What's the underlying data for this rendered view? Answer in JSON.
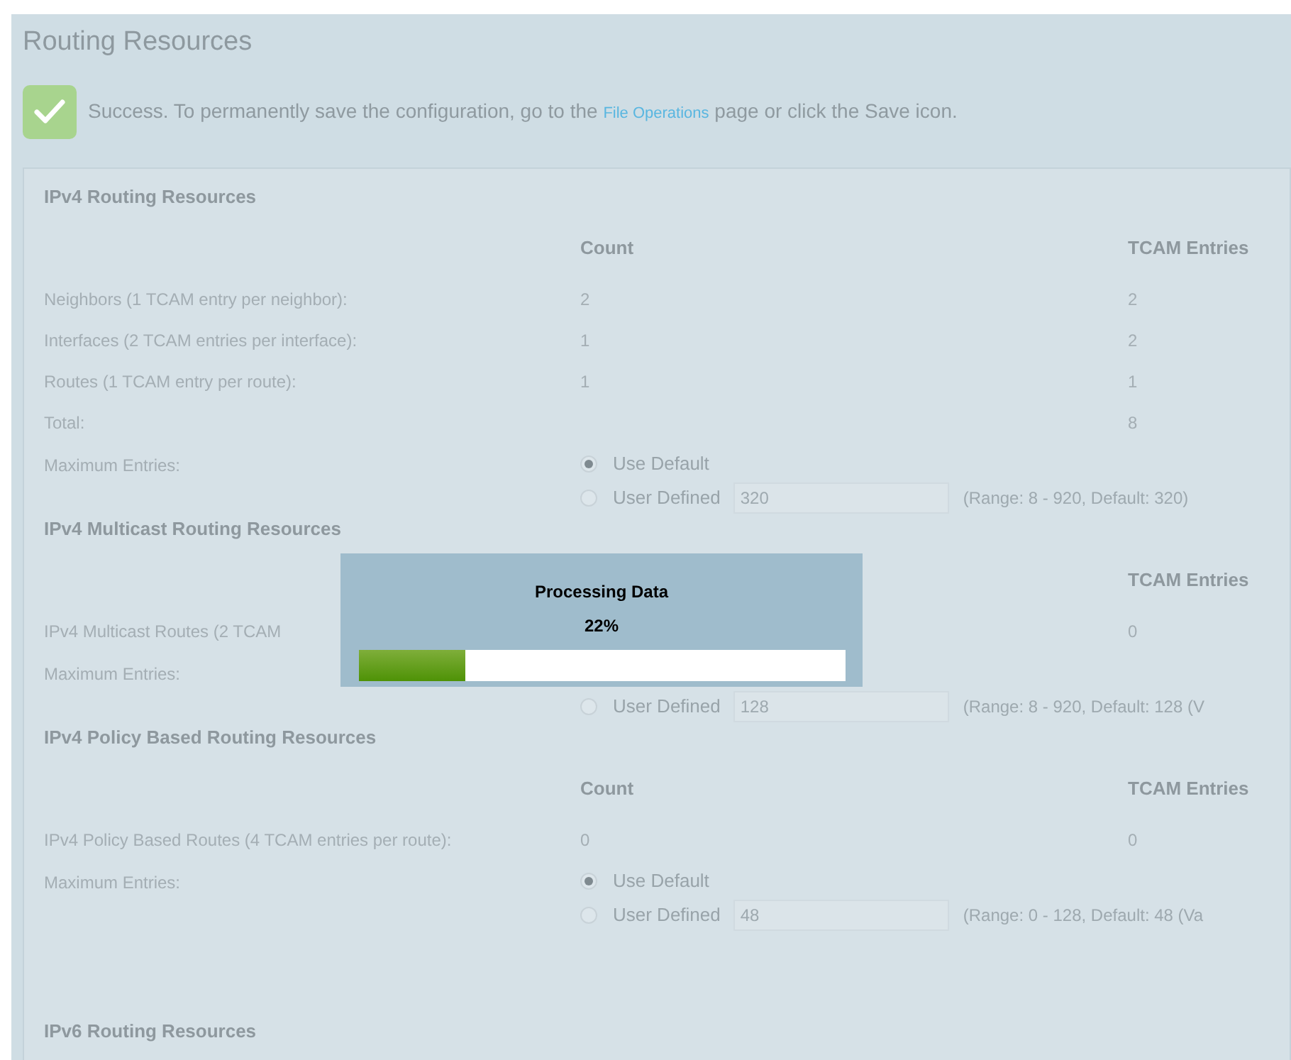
{
  "page": {
    "title": "Routing Resources"
  },
  "notice": {
    "text": "Success. To permanently save the configuration, go to the",
    "link": "File Operations",
    "after": "page or click the Save icon."
  },
  "sections": [
    {
      "title": "IPv4 Routing Resources",
      "headers": {
        "count": "Count",
        "tcam": "TCAM Entries"
      },
      "rows": [
        {
          "label": "Neighbors (1 TCAM entry per neighbor):",
          "count": "2",
          "tcam": "2"
        },
        {
          "label": "Interfaces (2 TCAM entries per interface):",
          "count": "1",
          "tcam": "2"
        },
        {
          "label": "Routes (1 TCAM entry per route):",
          "count": "1",
          "tcam": "1"
        },
        {
          "label": "Total:",
          "tcam": "8"
        }
      ],
      "max": {
        "label": "Maximum Entries:",
        "options": [
          {
            "label": "Use Default",
            "selected": true
          },
          {
            "label": "User Defined",
            "selected": false
          }
        ],
        "value": "320",
        "hint": "(Range: 8 - 920, Default: 320)"
      }
    },
    {
      "title": "IPv4 Multicast Routing Resources",
      "headers": {
        "tcam": "TCAM Entries"
      },
      "rows": [
        {
          "label": "IPv4 Multicast Routes (2 TCAM",
          "tcam": "0"
        }
      ],
      "max": {
        "label": "Maximum Entries:",
        "options": [
          {
            "label": "User Defined",
            "selected": false
          }
        ],
        "value": "128",
        "hint": "(Range: 8 - 920, Default: 128 (V"
      }
    },
    {
      "title": "IPv4 Policy Based Routing Resources",
      "headers": {
        "count": "Count",
        "tcam": "TCAM Entries"
      },
      "rows": [
        {
          "label": "IPv4 Policy Based Routes (4 TCAM entries per route):",
          "count": "0",
          "tcam": "0"
        }
      ],
      "max": {
        "label": "Maximum Entries:",
        "options": [
          {
            "label": "Use Default",
            "selected": true
          },
          {
            "label": "User Defined",
            "selected": false
          }
        ],
        "value": "48",
        "hint": "(Range: 0 - 128, Default: 48 (Va"
      }
    },
    {
      "title": "IPv6 Routing Resources"
    }
  ],
  "progress": {
    "title": "Processing Data",
    "percent": "22%",
    "level": 0.22
  }
}
